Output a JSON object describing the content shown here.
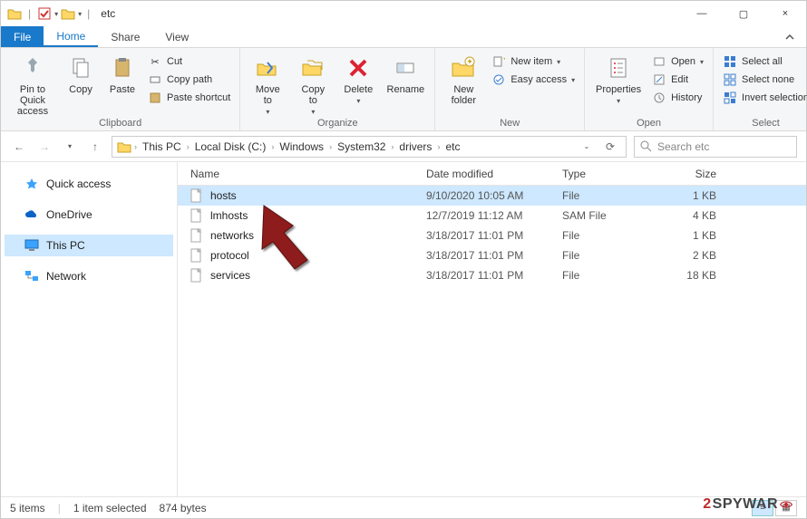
{
  "window": {
    "title": "etc",
    "controls": {
      "min": "—",
      "max": "▢",
      "close": "×"
    }
  },
  "tabs": {
    "file": "File",
    "home": "Home",
    "share": "Share",
    "view": "View"
  },
  "ribbon": {
    "clipboard": {
      "label": "Clipboard",
      "pin": "Pin to Quick\naccess",
      "copy": "Copy",
      "paste": "Paste",
      "cut": "Cut",
      "copy_path": "Copy path",
      "paste_shortcut": "Paste shortcut"
    },
    "organize": {
      "label": "Organize",
      "move_to": "Move\nto",
      "copy_to": "Copy\nto",
      "delete": "Delete",
      "rename": "Rename"
    },
    "new": {
      "label": "New",
      "new_folder": "New\nfolder",
      "new_item": "New item",
      "easy_access": "Easy access"
    },
    "open": {
      "label": "Open",
      "properties": "Properties",
      "open": "Open",
      "edit": "Edit",
      "history": "History"
    },
    "select": {
      "label": "Select",
      "select_all": "Select all",
      "select_none": "Select none",
      "invert": "Invert selection"
    }
  },
  "breadcrumbs": [
    "This PC",
    "Local Disk (C:)",
    "Windows",
    "System32",
    "drivers",
    "etc"
  ],
  "search": {
    "placeholder": "Search etc"
  },
  "sidebar": {
    "items": [
      {
        "label": "Quick access"
      },
      {
        "label": "OneDrive"
      },
      {
        "label": "This PC"
      },
      {
        "label": "Network"
      }
    ]
  },
  "columns": {
    "name": "Name",
    "date": "Date modified",
    "type": "Type",
    "size": "Size"
  },
  "files": [
    {
      "name": "hosts",
      "date": "9/10/2020 10:05 AM",
      "type": "File",
      "size": "1 KB",
      "selected": true
    },
    {
      "name": "lmhosts",
      "date": "12/7/2019 11:12 AM",
      "type": "SAM File",
      "size": "4 KB",
      "selected": false
    },
    {
      "name": "networks",
      "date": "3/18/2017 11:01 PM",
      "type": "File",
      "size": "1 KB",
      "selected": false
    },
    {
      "name": "protocol",
      "date": "3/18/2017 11:01 PM",
      "type": "File",
      "size": "2 KB",
      "selected": false
    },
    {
      "name": "services",
      "date": "3/18/2017 11:01 PM",
      "type": "File",
      "size": "18 KB",
      "selected": false
    }
  ],
  "status": {
    "count": "5 items",
    "selection": "1 item selected",
    "bytes": "874 bytes"
  },
  "watermark": {
    "left": "2",
    "mid": "SPYWAR"
  }
}
